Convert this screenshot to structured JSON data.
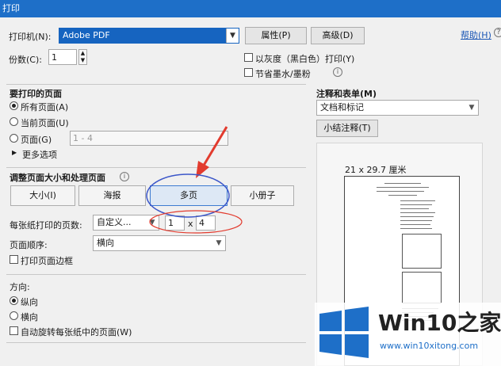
{
  "window": {
    "title": "打印"
  },
  "printer": {
    "label": "打印机(N):",
    "selected": "Adobe PDF",
    "properties_btn": "属性(P)",
    "advanced_btn": "高级(D)",
    "help_link": "帮助(H)"
  },
  "copies": {
    "label": "份数(C):",
    "value": "1"
  },
  "options": {
    "grayscale": "以灰度（黑白色）打印(Y)",
    "save_ink": "节省墨水/墨粉"
  },
  "pages_to_print": {
    "heading": "要打印的页面",
    "all": "所有页面(A)",
    "current": "当前页面(U)",
    "pages": "页面(G)",
    "pages_value": "1 - 4",
    "more": "更多选项"
  },
  "page_sizing": {
    "heading": "调整页面大小和处理页面",
    "tabs": [
      "大小(I)",
      "海报",
      "多页",
      "小册子"
    ],
    "pages_per_sheet_label": "每张纸打印的页数:",
    "pages_per_sheet_value": "自定义...",
    "cols": "1",
    "times": "x",
    "rows": "4",
    "order_label": "页面顺序:",
    "order_value": "横向",
    "print_border": "打印页面边框"
  },
  "orientation": {
    "heading": "方向:",
    "portrait": "纵向",
    "landscape": "横向",
    "auto_rotate": "自动旋转每张纸中的页面(W)"
  },
  "comments_forms": {
    "heading": "注释和表单(M)",
    "value": "文档和标记",
    "summarize_btn": "小结注释(T)"
  },
  "preview": {
    "size_label": "21 x 29.7 厘米"
  },
  "watermark": {
    "brand": "Win10",
    "brand_suffix": "之家",
    "url": "www.win10xitong.com"
  },
  "colors": {
    "titlebar": "#1e6fc8",
    "accent": "#1e6fc8",
    "annotation_red": "#e23b2e",
    "annotation_blue": "#3b56c9"
  }
}
